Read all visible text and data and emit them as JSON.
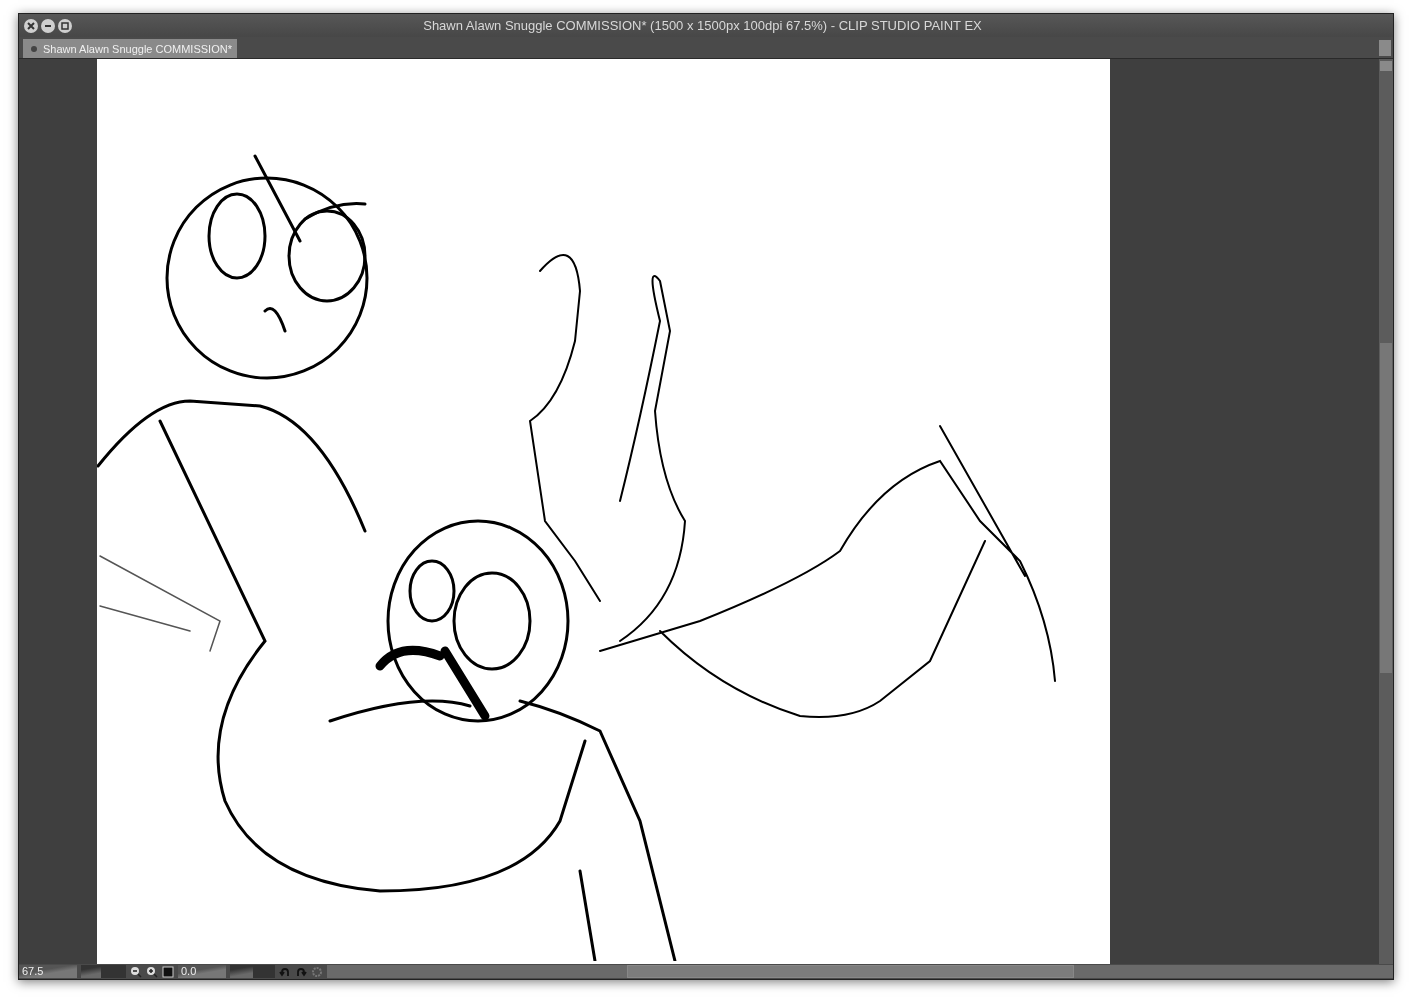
{
  "window": {
    "title": "Shawn Alawn Snuggle COMMISSION* (1500 x 1500px 100dpi 67.5%)  - CLIP STUDIO PAINT EX"
  },
  "tabs": [
    {
      "label": "Shawn Alawn Snuggle COMMISSION*",
      "selected": true
    }
  ],
  "status_bar": {
    "zoom": "67.5",
    "zoom_slider": {
      "level": 0.45
    },
    "rotation": "0.0",
    "rotation_slider": {
      "level": 0.5
    }
  }
}
